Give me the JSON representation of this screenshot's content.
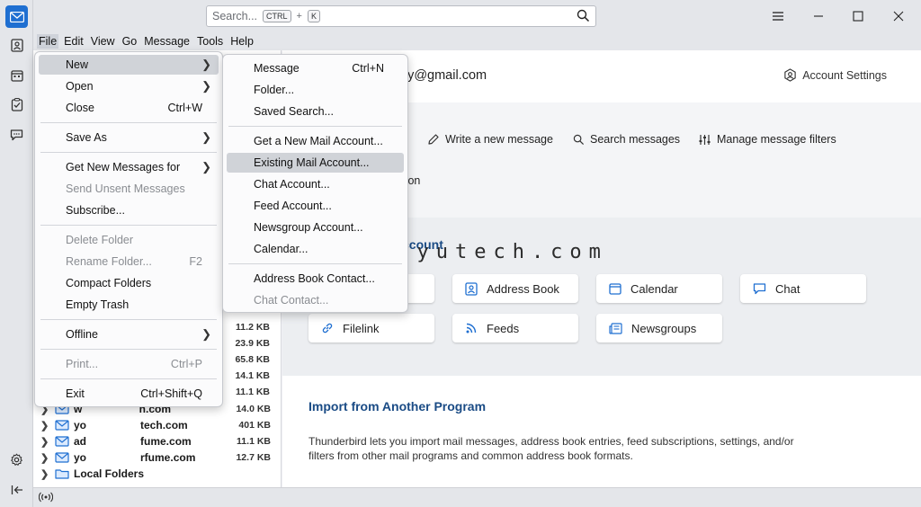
{
  "app": {
    "accent": "#1f6fd1"
  },
  "search": {
    "placeholder": "Search...",
    "kbd1": "CTRL",
    "plus": "+",
    "kbd2": "K"
  },
  "menubar": {
    "items": [
      "File",
      "Edit",
      "View",
      "Go",
      "Message",
      "Tools",
      "Help"
    ]
  },
  "file_menu": {
    "items": [
      {
        "label": "New",
        "accel": "",
        "submenu": true
      },
      {
        "label": "Open",
        "accel": "",
        "submenu": true
      },
      {
        "label": "Close",
        "accel": "Ctrl+W"
      },
      {
        "label": "Save As",
        "accel": "",
        "submenu": true
      },
      {
        "label": "Get New Messages for",
        "accel": "",
        "submenu": true
      },
      {
        "label": "Send Unsent Messages",
        "accel": "",
        "disabled": true
      },
      {
        "label": "Subscribe...",
        "accel": ""
      },
      {
        "label": "Delete Folder",
        "accel": "",
        "disabled": true
      },
      {
        "label": "Rename Folder...",
        "accel": "F2",
        "disabled": true
      },
      {
        "label": "Compact Folders",
        "accel": ""
      },
      {
        "label": "Empty Trash",
        "accel": ""
      },
      {
        "label": "Offline",
        "accel": "",
        "submenu": true
      },
      {
        "label": "Print...",
        "accel": "Ctrl+P",
        "disabled": true
      },
      {
        "label": "Exit",
        "accel": "Ctrl+Shift+Q"
      }
    ]
  },
  "new_submenu": {
    "items": [
      {
        "label": "Message",
        "accel": "Ctrl+N"
      },
      {
        "label": "Folder..."
      },
      {
        "label": "Saved Search..."
      },
      {
        "label": "Get a New Mail Account..."
      },
      {
        "label": "Existing Mail Account..."
      },
      {
        "label": "Chat Account..."
      },
      {
        "label": "Feed Account..."
      },
      {
        "label": "Newsgroup Account..."
      },
      {
        "label": "Calendar..."
      },
      {
        "label": "Address Book Contact..."
      },
      {
        "label": "Chat Contact...",
        "disabled": true
      }
    ]
  },
  "folders": {
    "sizes": [
      "11.2 KB",
      "23.9 KB",
      "65.8 KB",
      "14.1 KB",
      "11.1 KB"
    ],
    "rows": [
      {
        "name": "w                   n.com",
        "size": "14.0 KB"
      },
      {
        "name": "yo                  tech.com",
        "size": "401 KB"
      },
      {
        "name": "ad                  fume.com",
        "size": "11.1 KB"
      },
      {
        "name": "yo                  rfume.com",
        "size": "12.7 KB"
      },
      {
        "name": "Local Folders",
        "size": ""
      }
    ]
  },
  "account": {
    "email": "gy@gmail.com",
    "settings_label": "Account Settings",
    "actions": {
      "write": "Write a new message",
      "search": "Search messages",
      "filters": "Manage message filters"
    },
    "encryption": "yption"
  },
  "setup": {
    "title": "ccount",
    "tiles": [
      "Address Book",
      "Calendar",
      "Chat",
      "Filelink",
      "Feeds",
      "Newsgroups"
    ]
  },
  "import": {
    "title": "Import from Another Program",
    "description": "Thunderbird lets you import mail messages, address book entries, feed subscriptions, settings, and/or filters from other mail programs and common address book formats."
  },
  "watermark": "www.yoyutech.com"
}
